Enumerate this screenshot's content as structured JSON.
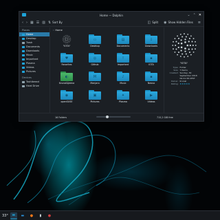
{
  "window": {
    "title": "Home — Dolphin",
    "buttons": {
      "minimize": "⌄",
      "maximize": "⌃",
      "close": "✕"
    }
  },
  "toolbar": {
    "back_icon": "‹",
    "forward_icon": "›",
    "view_icons": [
      "▦",
      "☰",
      "▥"
    ],
    "sort_label": "Sort By",
    "split_label": "Split",
    "hidden_label": "Show Hidden Files",
    "menu_icon": "≡"
  },
  "sidebar": {
    "places_header": "Places",
    "places": [
      {
        "label": "Home",
        "active": true,
        "color": "#1ea3d8"
      },
      {
        "label": "Desktop",
        "color": "#1ea3d8"
      },
      {
        "label": "Trash",
        "color": "#90a4ae"
      },
      {
        "label": "Documents",
        "color": "#1ea3d8"
      },
      {
        "label": "Downloads",
        "color": "#1ea3d8"
      },
      {
        "label": "Music",
        "color": "#1ea3d8"
      },
      {
        "label": "Important",
        "color": "#1ea3d8"
      },
      {
        "label": "Plasma",
        "color": "#1ea3d8"
      },
      {
        "label": "Videos",
        "color": "#1ea3d8"
      },
      {
        "label": "Pictures",
        "color": "#1ea3d8"
      }
    ],
    "devices_header": "Devices",
    "devices": [
      {
        "label": "Toshibread",
        "color": "#90a4ae"
      },
      {
        "label": "Hard Drive",
        "color": "#90a4ae"
      }
    ]
  },
  "breadcrumb": {
    "label": "Home"
  },
  "files": [
    {
      "label": "\"IOTA\"",
      "type": "iota",
      "selected": true
    },
    {
      "label": "Desktop",
      "glyph": "▭"
    },
    {
      "label": "Documents",
      "glyph": "▤"
    },
    {
      "label": "Downloads",
      "glyph": "⇩"
    },
    {
      "label": "Favorites",
      "glyph": "♥"
    },
    {
      "label": "Github",
      "glyph": "◎"
    },
    {
      "label": "Important",
      "glyph": "!"
    },
    {
      "label": "IOTA",
      "glyph": "▪"
    },
    {
      "label": "Krunal&Jeena",
      "type": "green",
      "glyph": "◐"
    },
    {
      "label": "Manjaro",
      "glyph": "M"
    },
    {
      "label": "Music",
      "glyph": "♪"
    },
    {
      "label": "Neovo",
      "glyph": "▪"
    },
    {
      "label": "openSUSE",
      "glyph": "◉"
    },
    {
      "label": "Pictures",
      "glyph": "▣"
    },
    {
      "label": "Plasma",
      "glyph": "✦"
    },
    {
      "label": "Videos",
      "glyph": "▶"
    }
  ],
  "info": {
    "name": "\"IOTA\"",
    "rows": [
      {
        "key": "Type:",
        "value": "Folder"
      },
      {
        "key": "Size:",
        "value": "7 Items"
      },
      {
        "key": "Created:",
        "value": "Sunday, 30"
      },
      {
        "key": "",
        "value": "September 2018"
      },
      {
        "key": "",
        "value": "09:21:38 CEST"
      },
      {
        "key": "Owner:",
        "value": "Krunal"
      },
      {
        "key": "Rating:",
        "value": "★★★★★"
      }
    ]
  },
  "status": {
    "count": "16 Folders",
    "free_space": "715,2 GiB free"
  },
  "taskbar": {
    "weather": "33°",
    "items": [
      {
        "name": "dolphin",
        "glyph": "▬",
        "color": "#1ea3d8",
        "active": true
      },
      {
        "name": "desktop-app",
        "glyph": "▬",
        "color": "#2a8fd8"
      },
      {
        "name": "firefox",
        "glyph": "●",
        "color": "#ff7a1a"
      },
      {
        "name": "terminal",
        "glyph": "▮",
        "color": "#cfd8dc"
      },
      {
        "name": "app",
        "glyph": "●",
        "color": "#d23c3c"
      }
    ]
  },
  "colors": {
    "accent": "#1ea3d8",
    "window_bg": "#1b1f24"
  }
}
